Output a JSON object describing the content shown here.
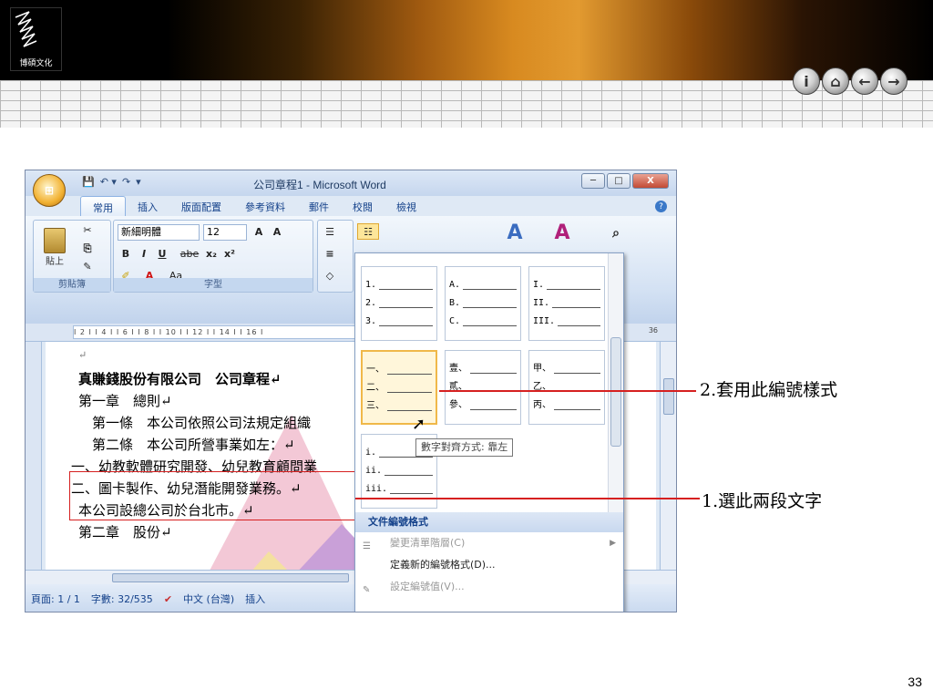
{
  "brand": {
    "logo_text": "博碩文化"
  },
  "nav": {
    "info": "i",
    "home": "⌂",
    "back": "←",
    "forward": "→"
  },
  "page_number": "33",
  "word": {
    "office_button": "⊞",
    "qat": {
      "save": "💾",
      "undo": "↶ ▾",
      "redo": "↷",
      "customize": "▾"
    },
    "title": "公司章程1 - Microsoft Word",
    "window_controls": {
      "minimize": "─",
      "maximize": "□",
      "close": "X"
    },
    "tabs": [
      "常用",
      "插入",
      "版面配置",
      "參考資料",
      "郵件",
      "校閱",
      "檢視"
    ],
    "ribbon": {
      "clipboard_label": "剪貼簿",
      "paste_label": "貼上",
      "font_label": "字型",
      "font_name": "新細明體",
      "font_size": "12",
      "bold": "B",
      "italic": "I",
      "underline": "U",
      "strike": "abe",
      "subscript": "x₂",
      "superscript": "x²",
      "change_case": "Aa",
      "grow": "A",
      "shrink": "A"
    },
    "ruler_ticks": "I 2 I  I 4 I  I 6 I  I 8 I  I 10 I  I 12 I  I 14 I  I 16 I",
    "ruler_end": "36",
    "document": {
      "lines": [
        "↵",
        "真賺錢股份有限公司　公司章程↵",
        "第一章　總則↵",
        "　第一條　本公司依照公司法規定組織",
        "　第二條　本公司所營事業如左：↵",
        "一、幼教軟體研究開發、幼兒教育顧問業",
        "二、圖卡製作、幼兒潛能開發業務。↵",
        "本公司設總公司於台北市。↵",
        "第二章　股份↵"
      ]
    },
    "status": {
      "page": "頁面: 1 / 1",
      "words": "字數: 32/535",
      "language": "中文 (台灣)",
      "mode": "插入"
    }
  },
  "numbering_dropdown": {
    "formats": [
      {
        "rows": [
          "1.",
          "2.",
          "3."
        ]
      },
      {
        "rows": [
          "A.",
          "B.",
          "C."
        ]
      },
      {
        "rows": [
          "I.",
          "II.",
          "III."
        ]
      },
      {
        "rows": [
          "一、",
          "二、",
          "三、"
        ]
      },
      {
        "rows": [
          "壹、",
          "貳、",
          "參、"
        ]
      },
      {
        "rows": [
          "甲、",
          "乙、",
          "丙、"
        ]
      },
      {
        "rows": [
          "i.",
          "ii.",
          "iii."
        ]
      }
    ],
    "tooltip": "數字對齊方式: 靠左",
    "section_header": "文件編號格式",
    "menu": [
      {
        "label": "變更清單階層(C)",
        "disabled": true
      },
      {
        "label": "定義新的編號格式(D)...",
        "disabled": false
      },
      {
        "label": "設定編號值(V)...",
        "disabled": true
      }
    ]
  },
  "callouts": {
    "step2": "2.套用此編號樣式",
    "step1": "1.選此兩段文字"
  }
}
